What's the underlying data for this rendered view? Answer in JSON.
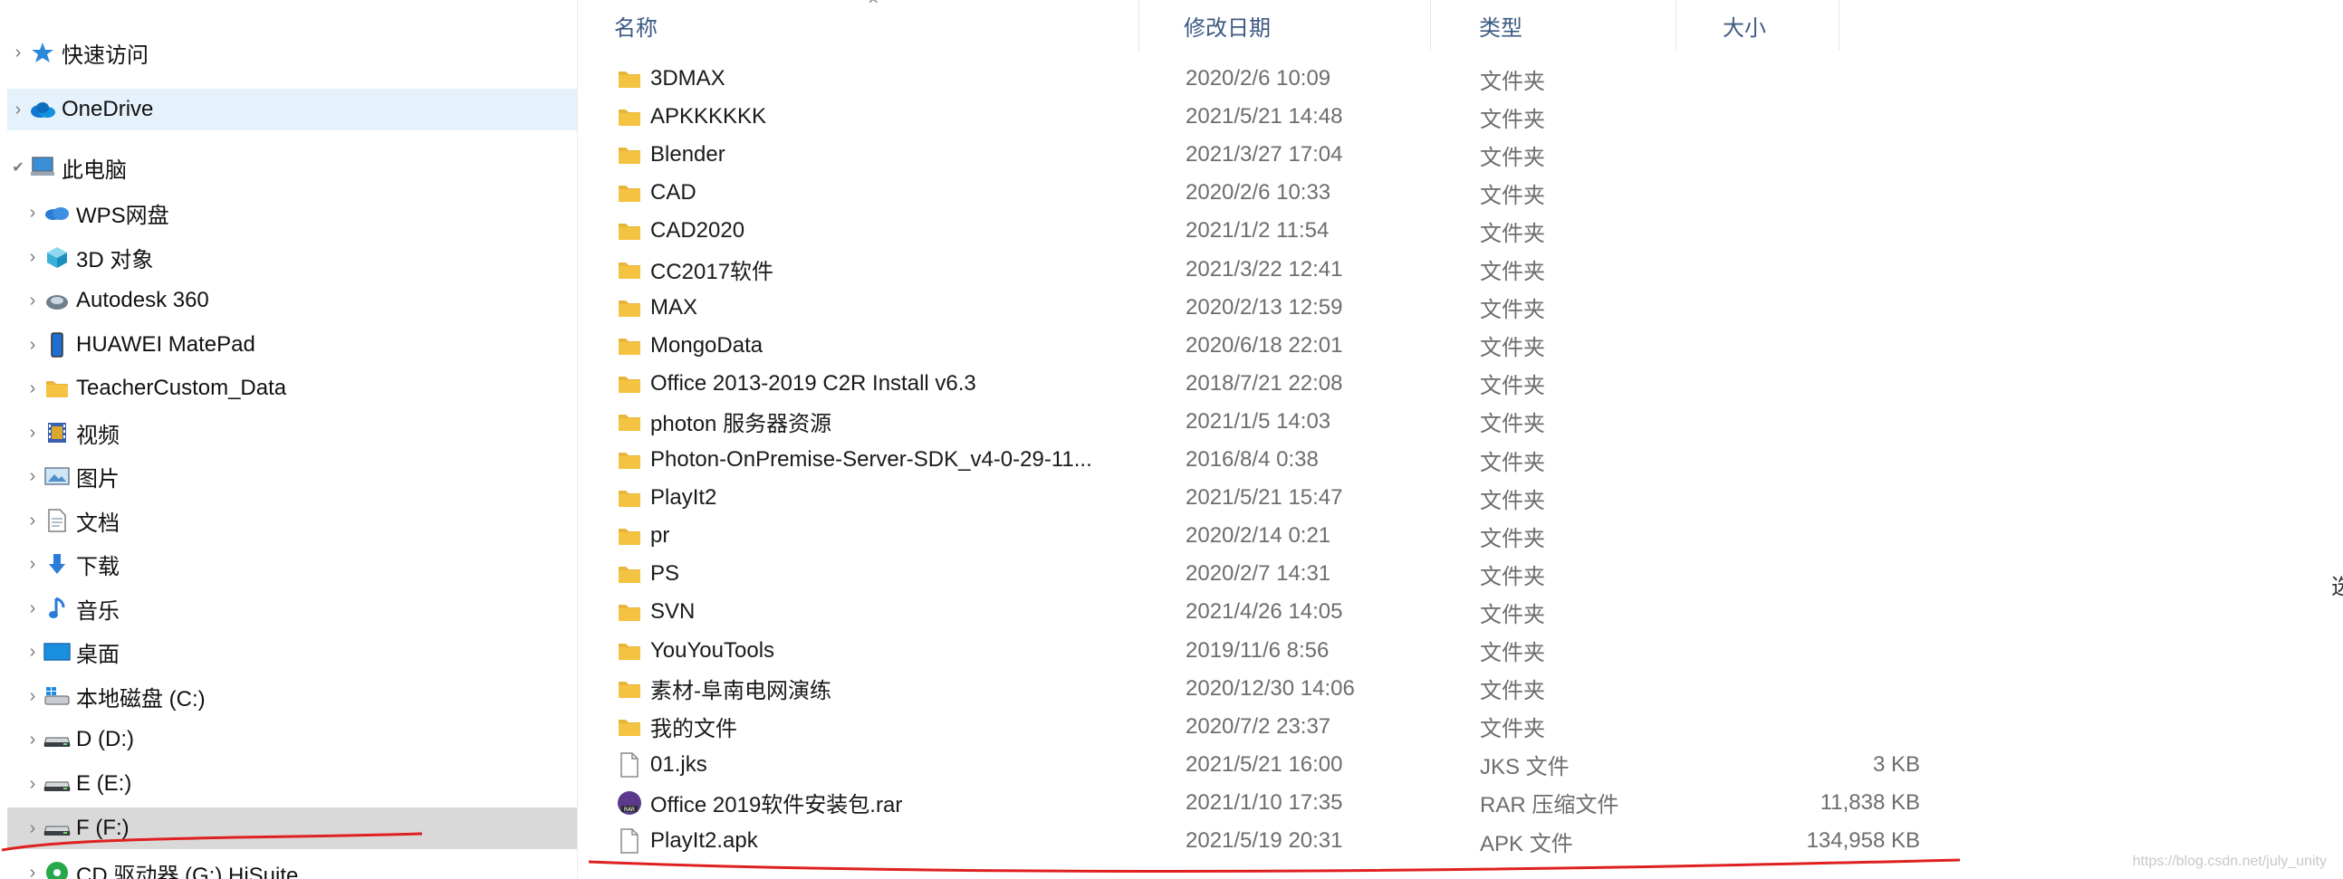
{
  "nav": {
    "quick_access": "快速访问",
    "onedrive": "OneDrive",
    "this_pc": "此电脑",
    "items": [
      "WPS网盘",
      "3D 对象",
      "Autodesk 360",
      "HUAWEI MatePad",
      "TeacherCustom_Data",
      "视频",
      "图片",
      "文档",
      "下载",
      "音乐",
      "桌面",
      "本地磁盘 (C:)",
      "D (D:)",
      "E (E:)",
      "F (F:)",
      "CD 驱动器 (G:) HiSuite"
    ],
    "icons": [
      "cloud-icon",
      "cube-3d-icon",
      "autodesk-icon",
      "tablet-icon",
      "folder-icon",
      "video-icon",
      "picture-icon",
      "document-icon",
      "download-icon",
      "music-icon",
      "desktop-icon",
      "windows-drive-icon",
      "drive-icon",
      "drive-icon",
      "drive-icon",
      "cd-drive-icon"
    ]
  },
  "columns": {
    "name": "名称",
    "date": "修改日期",
    "type": "类型",
    "size": "大小"
  },
  "files": [
    {
      "name": "3DMAX",
      "date": "2020/2/6 10:09",
      "type": "文件夹",
      "size": "",
      "icon": "folder"
    },
    {
      "name": "APKKKKKK",
      "date": "2021/5/21 14:48",
      "type": "文件夹",
      "size": "",
      "icon": "folder"
    },
    {
      "name": "Blender",
      "date": "2021/3/27 17:04",
      "type": "文件夹",
      "size": "",
      "icon": "folder"
    },
    {
      "name": "CAD",
      "date": "2020/2/6 10:33",
      "type": "文件夹",
      "size": "",
      "icon": "folder"
    },
    {
      "name": "CAD2020",
      "date": "2021/1/2 11:54",
      "type": "文件夹",
      "size": "",
      "icon": "folder"
    },
    {
      "name": "CC2017软件",
      "date": "2021/3/22 12:41",
      "type": "文件夹",
      "size": "",
      "icon": "folder"
    },
    {
      "name": "MAX",
      "date": "2020/2/13 12:59",
      "type": "文件夹",
      "size": "",
      "icon": "folder"
    },
    {
      "name": "MongoData",
      "date": "2020/6/18 22:01",
      "type": "文件夹",
      "size": "",
      "icon": "folder"
    },
    {
      "name": "Office 2013-2019 C2R Install v6.3",
      "date": "2018/7/21 22:08",
      "type": "文件夹",
      "size": "",
      "icon": "folder"
    },
    {
      "name": "photon 服务器资源",
      "date": "2021/1/5 14:03",
      "type": "文件夹",
      "size": "",
      "icon": "folder"
    },
    {
      "name": "Photon-OnPremise-Server-SDK_v4-0-29-11...",
      "date": "2016/8/4 0:38",
      "type": "文件夹",
      "size": "",
      "icon": "folder"
    },
    {
      "name": "PlayIt2",
      "date": "2021/5/21 15:47",
      "type": "文件夹",
      "size": "",
      "icon": "folder"
    },
    {
      "name": "pr",
      "date": "2020/2/14 0:21",
      "type": "文件夹",
      "size": "",
      "icon": "folder"
    },
    {
      "name": "PS",
      "date": "2020/2/7 14:31",
      "type": "文件夹",
      "size": "",
      "icon": "folder"
    },
    {
      "name": "SVN",
      "date": "2021/4/26 14:05",
      "type": "文件夹",
      "size": "",
      "icon": "folder"
    },
    {
      "name": "YouYouTools",
      "date": "2019/11/6 8:56",
      "type": "文件夹",
      "size": "",
      "icon": "folder"
    },
    {
      "name": "素材-阜南电网演练",
      "date": "2020/12/30 14:06",
      "type": "文件夹",
      "size": "",
      "icon": "folder"
    },
    {
      "name": "我的文件",
      "date": "2020/7/2 23:37",
      "type": "文件夹",
      "size": "",
      "icon": "folder"
    },
    {
      "name": "01.jks",
      "date": "2021/5/21 16:00",
      "type": "JKS 文件",
      "size": "3 KB",
      "icon": "file"
    },
    {
      "name": "Office 2019软件安装包.rar",
      "date": "2021/1/10 17:35",
      "type": "RAR 压缩文件",
      "size": "11,838 KB",
      "icon": "rar"
    },
    {
      "name": "PlayIt2.apk",
      "date": "2021/5/19 20:31",
      "type": "APK 文件",
      "size": "134,958 KB",
      "icon": "file"
    }
  ],
  "watermark": "https://blog.csdn.net/july_unity",
  "edge_char": "选",
  "colors": {
    "folder": "#f5c342",
    "selected_blue": "#e5f1fb",
    "selected_gray": "#d9d9d9",
    "annotation_red": "#e02020"
  }
}
